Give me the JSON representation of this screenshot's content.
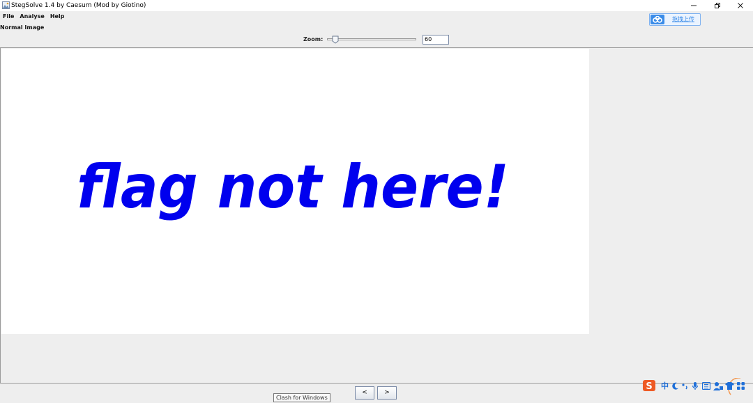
{
  "window": {
    "title": "StegSolve 1.4 by Caesum (Mod by Giotino)",
    "minimize_symbol": "–",
    "restore_symbol": "❐",
    "close_symbol": "✕"
  },
  "menu": {
    "items": [
      {
        "label": "File"
      },
      {
        "label": "Analyse"
      },
      {
        "label": "Help"
      }
    ]
  },
  "upload_widget": {
    "label": "拖拽上传",
    "icon": "cloud-link-icon",
    "accent": "#3b8ce8"
  },
  "panel": {
    "title": "Normal Image"
  },
  "zoom": {
    "label": "Zoom:",
    "value": "60",
    "level": 60,
    "min": 0,
    "max": 1000
  },
  "image": {
    "text": "flag not here!",
    "text_color": "#0000ee",
    "background": "#ffffff"
  },
  "navigation": {
    "prev_label": "<",
    "next_label": ">"
  },
  "tooltip": {
    "text": "Clash for Windows"
  },
  "tray": {
    "ime_char": "中",
    "icons": [
      "sogou-icon",
      "ime-chinese-icon",
      "moon-icon",
      "punctuation-icon",
      "microphone-icon",
      "keyboard-icon",
      "user-icon",
      "shirt-icon",
      "grid-icon"
    ]
  },
  "colors": {
    "window_bg": "#eeeeee",
    "border": "#9a9a9a",
    "flag_blue": "#0000ee",
    "sogou_orange": "#ee5a24",
    "tray_blue": "#1e6fd9"
  }
}
